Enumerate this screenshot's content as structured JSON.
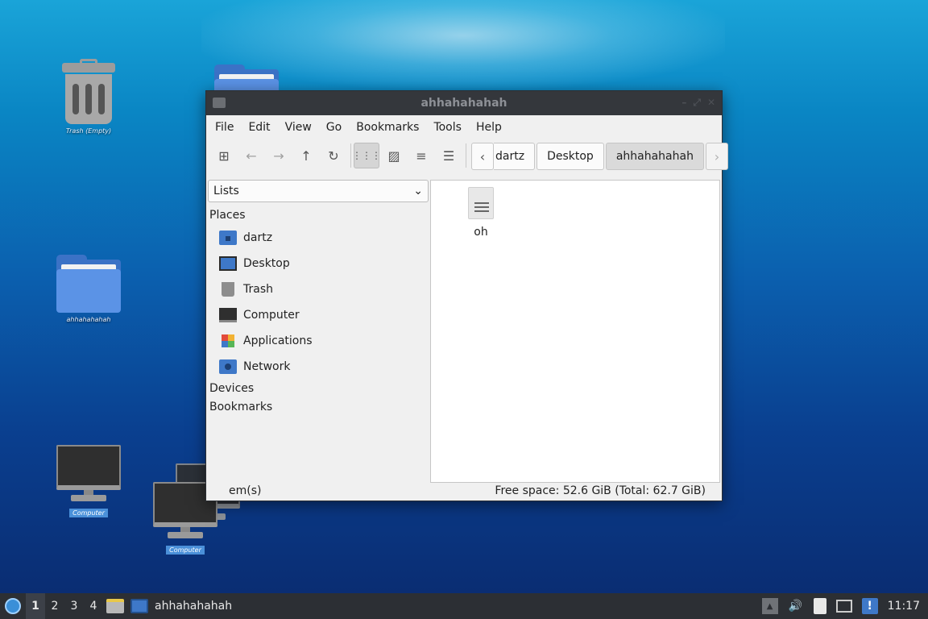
{
  "desktop": {
    "icons": [
      {
        "label": "Trash (Empty)"
      },
      {
        "label": "ahhahahahah"
      },
      {
        "label": "Computer"
      },
      {
        "label": "Computer"
      }
    ]
  },
  "window": {
    "title": "ahhahahahah",
    "menu": [
      "File",
      "Edit",
      "View",
      "Go",
      "Bookmarks",
      "Tools",
      "Help"
    ],
    "breadcrumb": {
      "cut_segment": "dartz",
      "segments": [
        "Desktop",
        "ahhahahahah"
      ]
    },
    "sidepane": {
      "mode": "Lists",
      "sections": {
        "places": "Places",
        "devices": "Devices",
        "bookmarks": "Bookmarks"
      },
      "places": [
        {
          "label": "dartz",
          "icon": "home-folder-icon"
        },
        {
          "label": "Desktop",
          "icon": "desktop-icon"
        },
        {
          "label": "Trash",
          "icon": "trash-icon"
        },
        {
          "label": "Computer",
          "icon": "computer-icon"
        },
        {
          "label": "Applications",
          "icon": "applications-icon"
        },
        {
          "label": "Network",
          "icon": "network-icon"
        }
      ]
    },
    "files": [
      {
        "name": "oh",
        "icon": "text-file-icon"
      }
    ],
    "status": {
      "items": "em(s)",
      "free_space": "Free space: 52.6 GiB (Total: 62.7 GiB)"
    }
  },
  "taskbar": {
    "workspaces": [
      "1",
      "2",
      "3",
      "4"
    ],
    "active_window": "ahhahahahah",
    "clock": "11:17"
  }
}
